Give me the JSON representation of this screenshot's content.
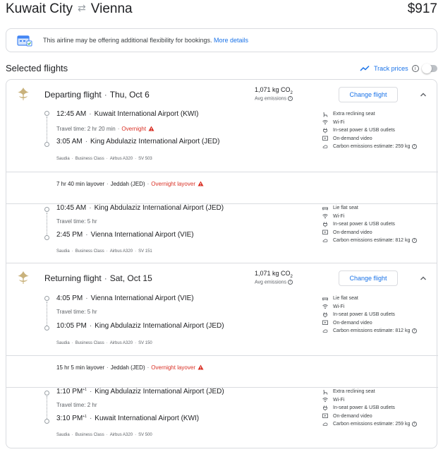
{
  "header": {
    "origin": "Kuwait City",
    "destination": "Vienna",
    "price": "$917"
  },
  "banner": {
    "text": "This airline may be offering additional flexibility for bookings.",
    "link": "More details"
  },
  "selected": {
    "title": "Selected flights",
    "track_label": "Track prices",
    "track_enabled": false
  },
  "colors": {
    "accent": "#1a73e8",
    "warning": "#d93025",
    "border": "#dadce0"
  },
  "departing": {
    "title": "Departing flight",
    "date": "Thu, Oct 6",
    "co2": "1,071 kg CO",
    "co2_sub": "2",
    "avg": "Avg emissions",
    "change_label": "Change flight",
    "leg1": {
      "dep_time": "12:45 AM",
      "dep_airport": "Kuwait International Airport (KWI)",
      "travel_time": "Travel time: 2 hr 20 min",
      "overnight": "Overnight",
      "arr_time": "3:05 AM",
      "arr_airport": "King Abdulaziz International Airport (JED)",
      "airline": "Saudia",
      "cabin": "Business Class",
      "aircraft": "Airbus A320",
      "flight_no": "SV 503",
      "amenities": [
        "Extra reclining seat",
        "Wi-Fi",
        "In-seat power & USB outlets",
        "On-demand video",
        "Carbon emissions estimate: 259 kg"
      ]
    },
    "layover": {
      "duration": "7 hr 40 min layover",
      "location": "Jeddah (JED)",
      "warning": "Overnight layover"
    },
    "leg2": {
      "dep_time": "10:45 AM",
      "dep_airport": "King Abdulaziz International Airport (JED)",
      "travel_time": "Travel time: 5 hr",
      "arr_time": "2:45 PM",
      "arr_airport": "Vienna International Airport (VIE)",
      "airline": "Saudia",
      "cabin": "Business Class",
      "aircraft": "Airbus A320",
      "flight_no": "SV 151",
      "amenities": [
        "Lie flat seat",
        "Wi-Fi",
        "In-seat power & USB outlets",
        "On-demand video",
        "Carbon emissions estimate: 812 kg"
      ]
    }
  },
  "returning": {
    "title": "Returning flight",
    "date": "Sat, Oct 15",
    "co2": "1,071 kg CO",
    "co2_sub": "2",
    "avg": "Avg emissions",
    "change_label": "Change flight",
    "leg1": {
      "dep_time": "4:05 PM",
      "dep_airport": "Vienna International Airport (VIE)",
      "travel_time": "Travel time: 5 hr",
      "arr_time": "10:05 PM",
      "arr_airport": "King Abdulaziz International Airport (JED)",
      "airline": "Saudia",
      "cabin": "Business Class",
      "aircraft": "Airbus A320",
      "flight_no": "SV 150",
      "amenities": [
        "Lie flat seat",
        "Wi-Fi",
        "In-seat power & USB outlets",
        "On-demand video",
        "Carbon emissions estimate: 812 kg"
      ]
    },
    "layover": {
      "duration": "15 hr 5 min layover",
      "location": "Jeddah (JED)",
      "warning": "Overnight layover"
    },
    "leg2": {
      "dep_time": "1:10 PM",
      "dep_day": "+1",
      "dep_airport": "King Abdulaziz International Airport (JED)",
      "travel_time": "Travel time: 2 hr",
      "arr_time": "3:10 PM",
      "arr_day": "+1",
      "arr_airport": "Kuwait International Airport (KWI)",
      "airline": "Saudia",
      "cabin": "Business Class",
      "aircraft": "Airbus A320",
      "flight_no": "SV 500",
      "amenities": [
        "Extra reclining seat",
        "Wi-Fi",
        "In-seat power & USB outlets",
        "On-demand video",
        "Carbon emissions estimate: 259 kg"
      ]
    }
  }
}
